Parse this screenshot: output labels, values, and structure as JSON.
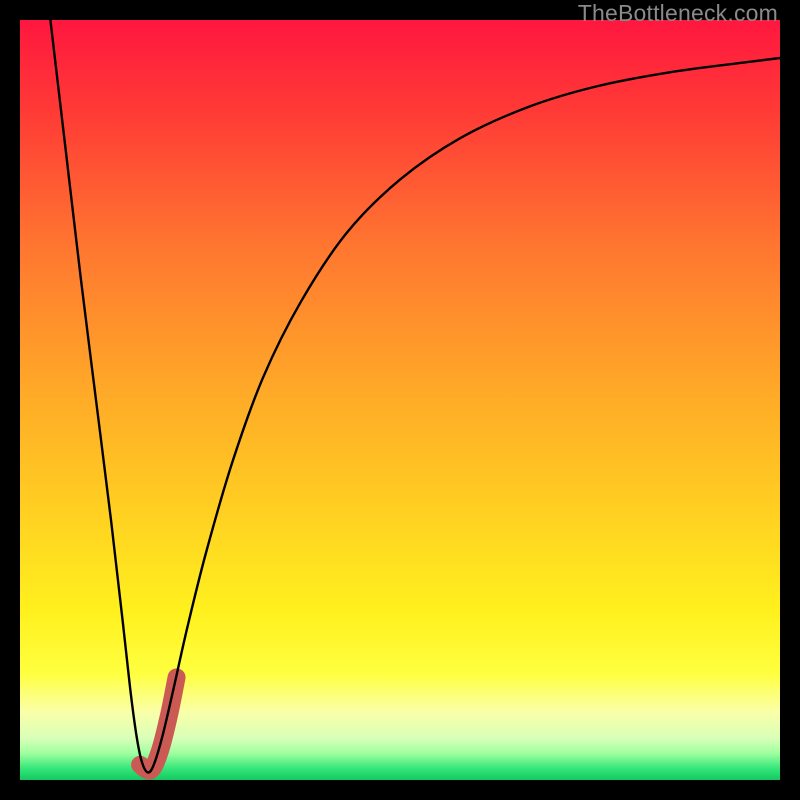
{
  "watermark": "TheBottleneck.com",
  "chart_data": {
    "type": "line",
    "title": "",
    "xlabel": "",
    "ylabel": "",
    "xlim": [
      0,
      100
    ],
    "ylim": [
      0,
      100
    ],
    "background_gradient": {
      "stops": [
        {
          "offset": 0.0,
          "color": "#ff173f"
        },
        {
          "offset": 0.12,
          "color": "#ff3a36"
        },
        {
          "offset": 0.3,
          "color": "#ff7730"
        },
        {
          "offset": 0.48,
          "color": "#ffa728"
        },
        {
          "offset": 0.66,
          "color": "#ffd321"
        },
        {
          "offset": 0.78,
          "color": "#fff11e"
        },
        {
          "offset": 0.86,
          "color": "#ffff40"
        },
        {
          "offset": 0.91,
          "color": "#faffa8"
        },
        {
          "offset": 0.945,
          "color": "#d9ffb8"
        },
        {
          "offset": 0.965,
          "color": "#9fff9f"
        },
        {
          "offset": 0.985,
          "color": "#34e67a"
        },
        {
          "offset": 1.0,
          "color": "#13c95f"
        }
      ]
    },
    "series": [
      {
        "name": "bottleneck-curve",
        "stroke": "#000000",
        "stroke_width": 2.4,
        "points": [
          {
            "x": 4.0,
            "y": 100.0
          },
          {
            "x": 6.0,
            "y": 83.0
          },
          {
            "x": 8.0,
            "y": 66.0
          },
          {
            "x": 10.0,
            "y": 50.0
          },
          {
            "x": 12.0,
            "y": 34.0
          },
          {
            "x": 13.5,
            "y": 21.0
          },
          {
            "x": 14.5,
            "y": 12.0
          },
          {
            "x": 15.3,
            "y": 6.0
          },
          {
            "x": 16.0,
            "y": 2.5
          },
          {
            "x": 16.8,
            "y": 1.0
          },
          {
            "x": 17.6,
            "y": 2.0
          },
          {
            "x": 18.8,
            "y": 6.0
          },
          {
            "x": 20.2,
            "y": 12.0
          },
          {
            "x": 22.0,
            "y": 20.0
          },
          {
            "x": 24.5,
            "y": 30.0
          },
          {
            "x": 28.0,
            "y": 42.0
          },
          {
            "x": 32.0,
            "y": 53.0
          },
          {
            "x": 37.0,
            "y": 63.0
          },
          {
            "x": 43.0,
            "y": 72.0
          },
          {
            "x": 50.0,
            "y": 79.0
          },
          {
            "x": 58.0,
            "y": 84.5
          },
          {
            "x": 67.0,
            "y": 88.6
          },
          {
            "x": 76.0,
            "y": 91.3
          },
          {
            "x": 86.0,
            "y": 93.2
          },
          {
            "x": 96.0,
            "y": 94.5
          },
          {
            "x": 100.0,
            "y": 95.0
          }
        ]
      },
      {
        "name": "highlight-marker",
        "stroke": "#cc5a54",
        "stroke_width": 18,
        "linecap": "round",
        "points": [
          {
            "x": 15.8,
            "y": 2.0
          },
          {
            "x": 17.2,
            "y": 1.3
          },
          {
            "x": 18.4,
            "y": 3.8
          },
          {
            "x": 19.6,
            "y": 8.5
          },
          {
            "x": 20.6,
            "y": 13.5
          }
        ]
      }
    ]
  }
}
